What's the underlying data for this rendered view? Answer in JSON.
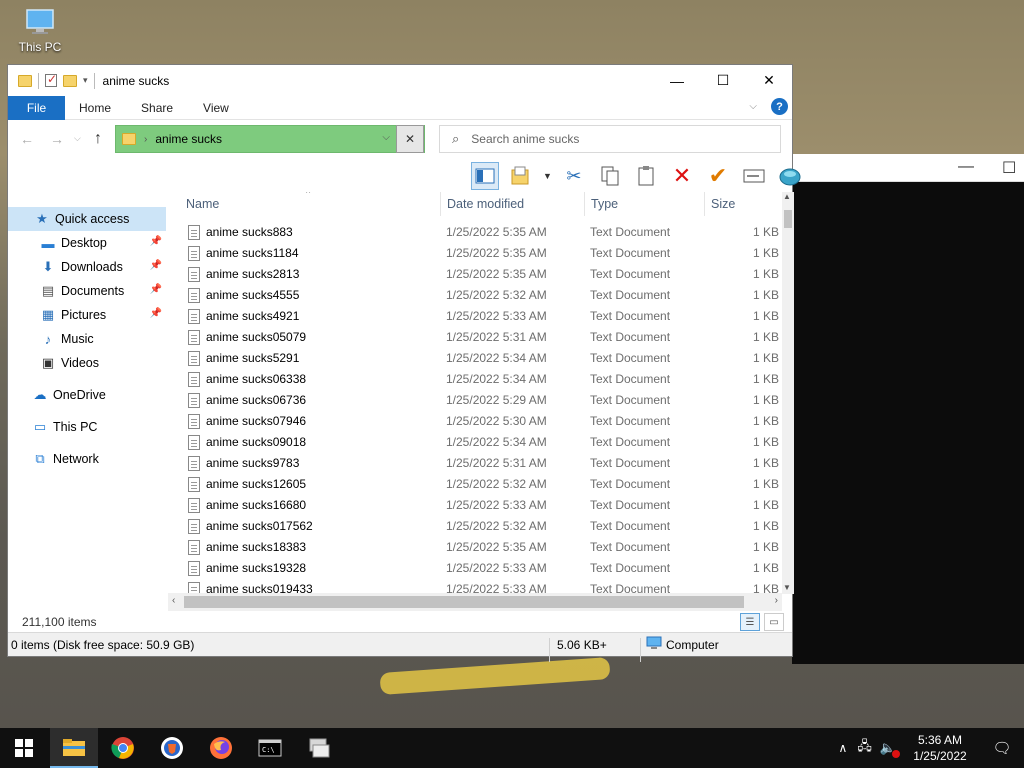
{
  "desktop": {
    "icon_label": "This PC"
  },
  "window": {
    "title": "anime sucks",
    "minimize": "—",
    "maximize": "☐",
    "close": "✕"
  },
  "ribbon": {
    "tabs": [
      "File",
      "Home",
      "Share",
      "View"
    ]
  },
  "address": {
    "path": "anime sucks",
    "search_placeholder": "Search anime sucks"
  },
  "nav_pane": {
    "items": [
      {
        "label": "Quick access",
        "icon": "star-icon",
        "pinned": false
      },
      {
        "label": "Desktop",
        "icon": "desktop-icon",
        "pinned": true
      },
      {
        "label": "Downloads",
        "icon": "download-icon",
        "pinned": true
      },
      {
        "label": "Documents",
        "icon": "documents-icon",
        "pinned": true
      },
      {
        "label": "Pictures",
        "icon": "pictures-icon",
        "pinned": true
      },
      {
        "label": "Music",
        "icon": "music-icon",
        "pinned": false
      },
      {
        "label": "Videos",
        "icon": "videos-icon",
        "pinned": false
      },
      {
        "label": "OneDrive",
        "icon": "cloud-icon",
        "pinned": false
      },
      {
        "label": "This PC",
        "icon": "computer-icon",
        "pinned": false
      },
      {
        "label": "Network",
        "icon": "network-icon",
        "pinned": false
      }
    ]
  },
  "columns": [
    "Name",
    "Date modified",
    "Type",
    "Size"
  ],
  "files": [
    {
      "name": "anime sucks883",
      "date": "1/25/2022 5:35 AM",
      "type": "Text Document",
      "size": "1 KB"
    },
    {
      "name": "anime sucks1184",
      "date": "1/25/2022 5:35 AM",
      "type": "Text Document",
      "size": "1 KB"
    },
    {
      "name": "anime sucks2813",
      "date": "1/25/2022 5:35 AM",
      "type": "Text Document",
      "size": "1 KB"
    },
    {
      "name": "anime sucks4555",
      "date": "1/25/2022 5:32 AM",
      "type": "Text Document",
      "size": "1 KB"
    },
    {
      "name": "anime sucks4921",
      "date": "1/25/2022 5:33 AM",
      "type": "Text Document",
      "size": "1 KB"
    },
    {
      "name": "anime sucks05079",
      "date": "1/25/2022 5:31 AM",
      "type": "Text Document",
      "size": "1 KB"
    },
    {
      "name": "anime sucks5291",
      "date": "1/25/2022 5:34 AM",
      "type": "Text Document",
      "size": "1 KB"
    },
    {
      "name": "anime sucks06338",
      "date": "1/25/2022 5:34 AM",
      "type": "Text Document",
      "size": "1 KB"
    },
    {
      "name": "anime sucks06736",
      "date": "1/25/2022 5:29 AM",
      "type": "Text Document",
      "size": "1 KB"
    },
    {
      "name": "anime sucks07946",
      "date": "1/25/2022 5:30 AM",
      "type": "Text Document",
      "size": "1 KB"
    },
    {
      "name": "anime sucks09018",
      "date": "1/25/2022 5:34 AM",
      "type": "Text Document",
      "size": "1 KB"
    },
    {
      "name": "anime sucks9783",
      "date": "1/25/2022 5:31 AM",
      "type": "Text Document",
      "size": "1 KB"
    },
    {
      "name": "anime sucks12605",
      "date": "1/25/2022 5:32 AM",
      "type": "Text Document",
      "size": "1 KB"
    },
    {
      "name": "anime sucks16680",
      "date": "1/25/2022 5:33 AM",
      "type": "Text Document",
      "size": "1 KB"
    },
    {
      "name": "anime sucks017562",
      "date": "1/25/2022 5:32 AM",
      "type": "Text Document",
      "size": "1 KB"
    },
    {
      "name": "anime sucks18383",
      "date": "1/25/2022 5:35 AM",
      "type": "Text Document",
      "size": "1 KB"
    },
    {
      "name": "anime sucks19328",
      "date": "1/25/2022 5:33 AM",
      "type": "Text Document",
      "size": "1 KB"
    },
    {
      "name": "anime sucks019433",
      "date": "1/25/2022 5:33 AM",
      "type": "Text Document",
      "size": "1 KB"
    }
  ],
  "status": {
    "item_count": "211,100 items",
    "selection": "0 items (Disk free space: 50.9 GB)",
    "size": "5.06 KB+",
    "location": "Computer"
  },
  "taskbar": {
    "apps": [
      "file-explorer-icon",
      "chrome-icon",
      "brave-icon",
      "firefox-icon",
      "terminal-icon",
      "network-tool-icon"
    ],
    "time": "5:36 AM",
    "date": "1/25/2022"
  },
  "colors": {
    "accent": "#1a6fc4",
    "address_highlight": "#7ecb7e",
    "selected_nav": "#cce4f7"
  }
}
